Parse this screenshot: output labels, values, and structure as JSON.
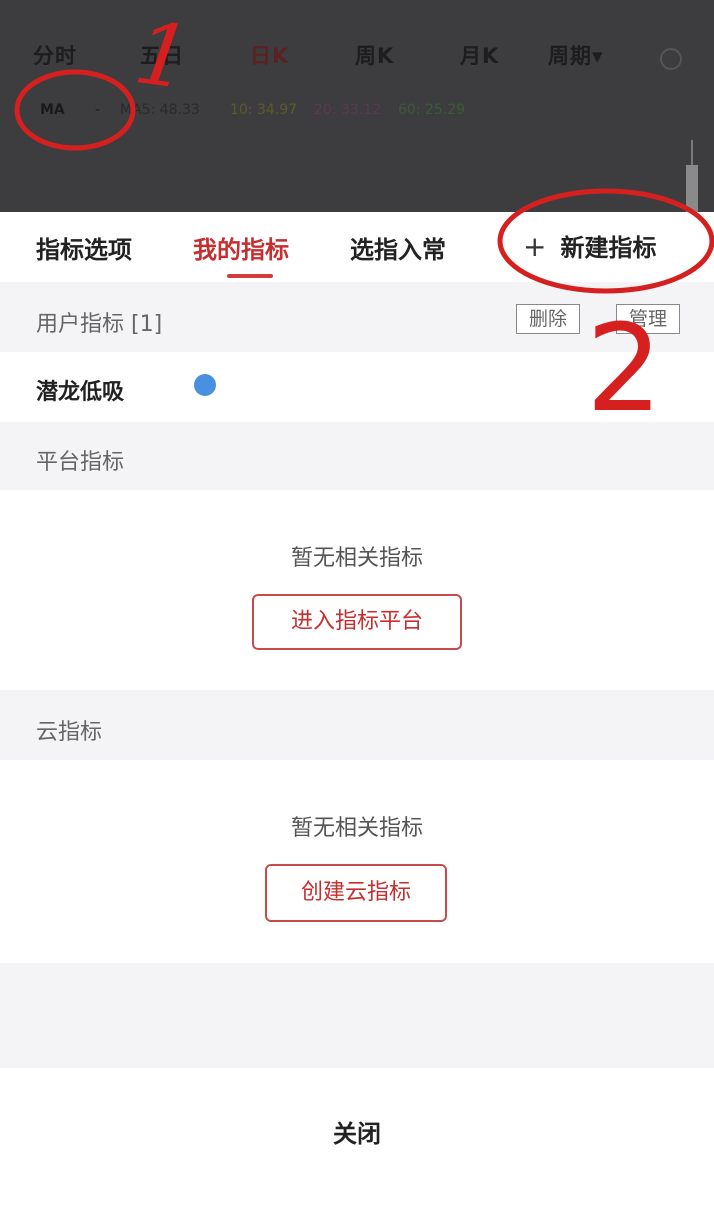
{
  "chart_header": {
    "period_tabs": [
      "分时",
      "五日",
      "日K",
      "周K",
      "月K",
      "周期▾"
    ],
    "ma_selector": "MA",
    "ma_dash": "-",
    "ma_values": [
      "MA5: 48.33",
      "10: 34.97",
      "20: 33.12",
      "60: 25.29"
    ]
  },
  "sheet": {
    "tabs": [
      "指标选项",
      "我的指标",
      "选指入常"
    ],
    "active_tab": "我的指标",
    "new_indicator_plus": "+",
    "new_indicator_label": "新建指标",
    "user_section": {
      "title": "用户指标 [1]",
      "delete_button": "删除",
      "manage_button": "管理",
      "items": [
        {
          "name": "潜龙低吸"
        }
      ]
    },
    "platform_section": {
      "title": "平台指标",
      "empty_text": "暂无相关指标",
      "action_button": "进入指标平台"
    },
    "cloud_section": {
      "title": "云指标",
      "empty_text": "暂无相关指标",
      "action_button": "创建云指标"
    },
    "close_label": "关闭"
  },
  "annotations": {
    "mark_1": "1",
    "mark_2": "2",
    "color": "#d6201f"
  },
  "colors": {
    "accent_red": "#c62f2f",
    "dot_blue": "#4a90e2"
  }
}
